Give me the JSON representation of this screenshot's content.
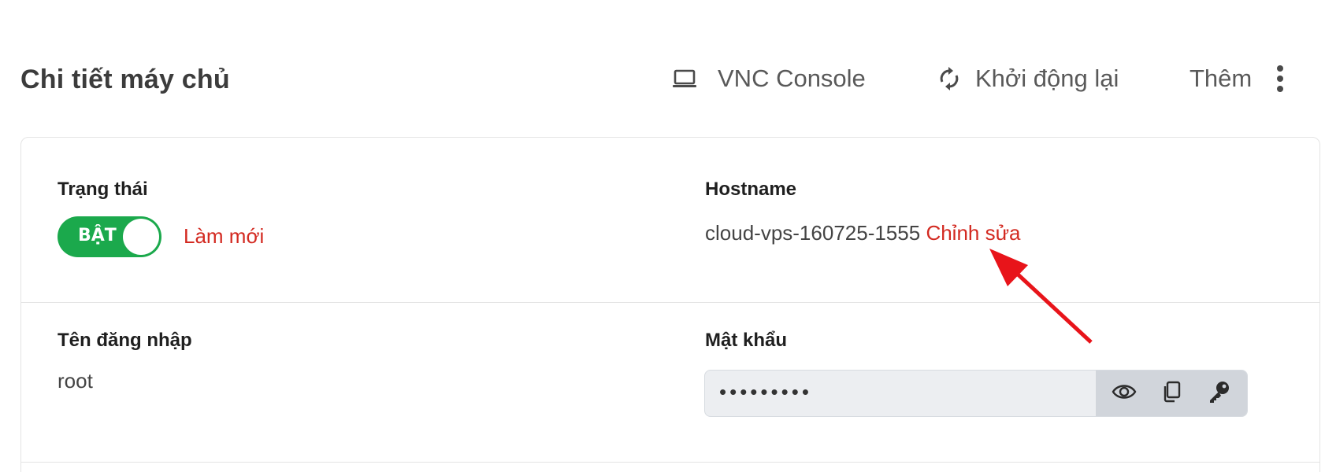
{
  "header": {
    "title": "Chi tiết máy chủ",
    "actions": {
      "vnc_label": "VNC Console",
      "restart_label": "Khởi động lại",
      "more_label": "Thêm"
    }
  },
  "status": {
    "label": "Trạng thái",
    "toggle_text": "BẬT",
    "refresh_link": "Làm mới"
  },
  "hostname": {
    "label": "Hostname",
    "value": "cloud-vps-160725-1555",
    "edit_link": "Chỉnh sửa"
  },
  "username": {
    "label": "Tên đăng nhập",
    "value": "root"
  },
  "password": {
    "label": "Mật khẩu",
    "masked": "•••••••••"
  },
  "colors": {
    "accent_red": "#d32a21",
    "toggle_green": "#1ba94c",
    "annotation_arrow": "#e8141a"
  },
  "icons": {
    "vnc": "laptop-icon",
    "restart": "refresh-icon",
    "more": "kebab-menu-icon",
    "show_password": "eye-icon",
    "copy_password": "copy-icon",
    "reset_password": "key-icon"
  }
}
